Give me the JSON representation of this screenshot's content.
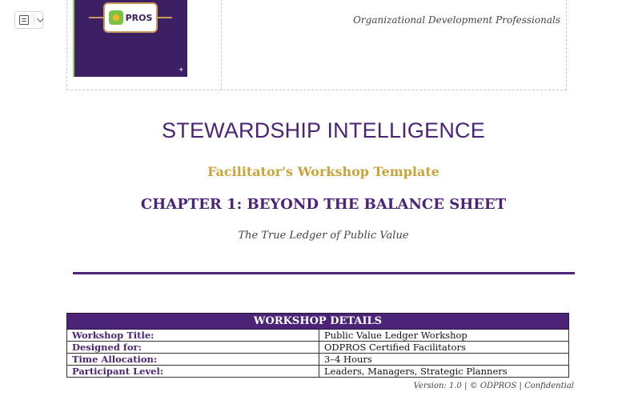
{
  "toolbar": {
    "icon": "document-outline-icon",
    "dropdown_icon": "chevron-down-icon"
  },
  "header": {
    "logo_text": "PROS",
    "org_name": "Organizational Development Professionals"
  },
  "colors": {
    "brand_purple": "#4b2477",
    "brand_gold": "#c9a43a",
    "logo_green": "#7cc243"
  },
  "document": {
    "title": "STEWARDSHIP INTELLIGENCE",
    "subtitle": "Facilitator's Workshop Template",
    "chapter": "CHAPTER 1: BEYOND THE BALANCE SHEET",
    "tagline": "The True Ledger of Public Value"
  },
  "workshop_details": {
    "heading": "WORKSHOP DETAILS",
    "rows": [
      {
        "label": "Workshop Title:",
        "value": "Public Value Ledger Workshop"
      },
      {
        "label": "Designed for:",
        "value": "ODPROS Certified Facilitators"
      },
      {
        "label": "Time Allocation:",
        "value": "3–4 Hours"
      },
      {
        "label": "Participant Level:",
        "value": "Leaders, Managers, Strategic Planners"
      }
    ]
  },
  "footer": {
    "version": "Version: 1.0 | © ODPROS | Confidential"
  }
}
